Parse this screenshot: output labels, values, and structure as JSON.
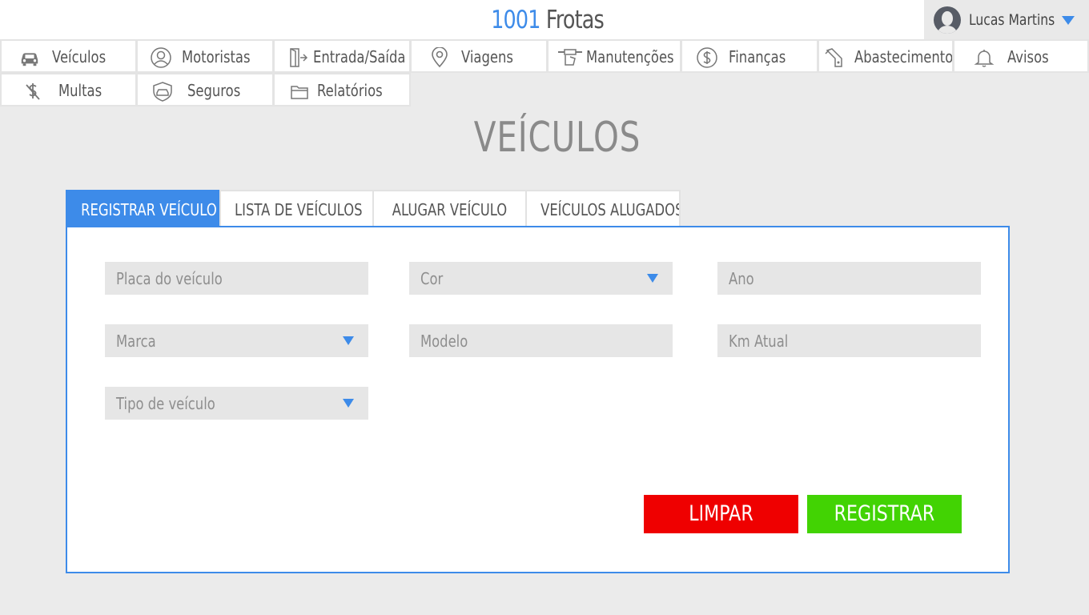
{
  "brand": {
    "number": "1001",
    "name": " Frotas"
  },
  "user": {
    "name": "Lucas Martins"
  },
  "nav": [
    {
      "label": "Veículos",
      "icon": "car-icon"
    },
    {
      "label": "Motoristas",
      "icon": "driver-icon"
    },
    {
      "label": "Entrada/Saída",
      "icon": "door-exit-icon"
    },
    {
      "label": "Viagens",
      "icon": "map-pin-icon"
    },
    {
      "label": "Manutenções",
      "icon": "wrench-hand-icon"
    },
    {
      "label": "Finanças",
      "icon": "dollar-icon"
    },
    {
      "label": "Abastecimento",
      "icon": "fuel-nozzle-icon"
    },
    {
      "label": "Avisos",
      "icon": "bell-icon"
    },
    {
      "label": "Multas",
      "icon": "dollar-slash-icon"
    },
    {
      "label": "Seguros",
      "icon": "insurance-car-icon"
    },
    {
      "label": "Relatórios",
      "icon": "folder-icon"
    }
  ],
  "page_title": "VEÍCULOS",
  "tabs": [
    {
      "label": "REGISTRAR VEÍCULO",
      "active": true
    },
    {
      "label": "LISTA DE VEÍCULOS",
      "active": false
    },
    {
      "label": "ALUGAR VEÍCULO",
      "active": false
    },
    {
      "label": "VEÍCULOS ALUGADOS",
      "active": false
    }
  ],
  "form": {
    "plate": {
      "placeholder": "Placa do veículo",
      "value": ""
    },
    "color": {
      "placeholder": "Cor",
      "value": ""
    },
    "year": {
      "placeholder": "Ano",
      "value": ""
    },
    "brand": {
      "placeholder": "Marca",
      "value": ""
    },
    "model": {
      "placeholder": "Modelo",
      "value": ""
    },
    "km": {
      "placeholder": "Km Atual",
      "value": ""
    },
    "type": {
      "placeholder": "Tipo de veículo",
      "value": ""
    }
  },
  "buttons": {
    "clear": "LIMPAR",
    "register": "REGISTRAR"
  },
  "colors": {
    "accent": "#3d8be9",
    "danger": "#ef0000",
    "success": "#42d303",
    "background": "#ebebeb"
  }
}
